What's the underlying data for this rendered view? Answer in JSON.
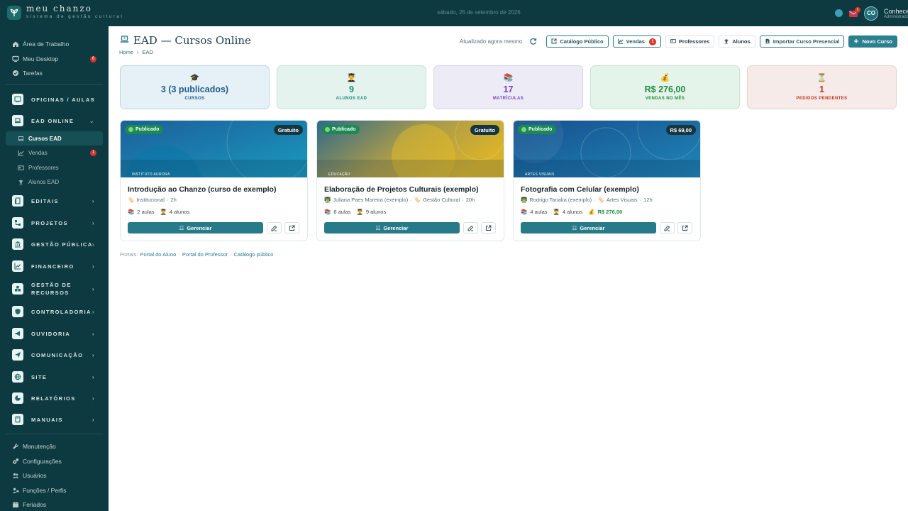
{
  "app": {
    "brand_name": "meu chanzo",
    "brand_subtitle": "sistema de gestão cultural",
    "date": "sábado, 26 de setembro de 2026",
    "notif_count": "1",
    "user_initials": "CO",
    "user_name": "Conhecer",
    "user_role": "Administrador"
  },
  "sidebar": {
    "top_items": [
      {
        "label": "Área de Trabalho",
        "icon": "home-icon"
      },
      {
        "label": "Meu Desktop",
        "icon": "monitor-icon",
        "badge": "6"
      },
      {
        "label": "Tarefas",
        "icon": "check-circle-icon"
      }
    ],
    "groups": [
      {
        "label": "OFICINAS / AULAS",
        "icon": "chalkboard-icon"
      },
      {
        "label": "EAD ONLINE",
        "icon": "laptop-icon",
        "expanded": true
      },
      {
        "label": "EDITAIS",
        "icon": "document-icon"
      },
      {
        "label": "PROJETOS",
        "icon": "diagram-icon"
      },
      {
        "label": "GESTÃO PÚBLICA",
        "icon": "bank-icon"
      },
      {
        "label": "FINANCEIRO",
        "icon": "chart-line-icon"
      },
      {
        "label": "GESTÃO DE RECURSOS",
        "icon": "boxes-icon"
      },
      {
        "label": "CONTROLADORIA",
        "icon": "shield-icon"
      },
      {
        "label": "OUVIDORIA",
        "icon": "megaphone-icon"
      },
      {
        "label": "COMUNICAÇÃO",
        "icon": "send-icon"
      },
      {
        "label": "SITE",
        "icon": "globe-icon"
      },
      {
        "label": "RELATÓRIOS",
        "icon": "pie-chart-icon"
      },
      {
        "label": "MANUAIS",
        "icon": "book-icon"
      }
    ],
    "ead_sub": [
      {
        "label": "Cursos EAD",
        "icon": "laptop-icon",
        "active": true
      },
      {
        "label": "Vendas",
        "icon": "chart-line-icon",
        "badge": "1"
      },
      {
        "label": "Professores",
        "icon": "id-card-icon"
      },
      {
        "label": "Alunos EAD",
        "icon": "student-icon"
      }
    ],
    "bottom_items": [
      {
        "label": "Manutenção",
        "icon": "wrench-icon"
      },
      {
        "label": "Configurações",
        "icon": "gears-icon"
      },
      {
        "label": "Usuários",
        "icon": "users-icon"
      },
      {
        "label": "Funções / Perfis",
        "icon": "user-tag-icon"
      },
      {
        "label": "Feriados",
        "icon": "calendar-icon"
      }
    ]
  },
  "page": {
    "title": "EAD — Cursos Online",
    "breadcrumb_home": "Home",
    "breadcrumb_current": "EAD",
    "updated_text": "Atualizado agora mesmo",
    "buttons": {
      "catalog": "Catálogo Público",
      "sales": "Vendas",
      "sales_badge": "1",
      "teachers": "Professores",
      "students": "Alunos",
      "import": "Importar Curso Presencial",
      "new": "Novo Curso"
    }
  },
  "stats": [
    {
      "icon": "🎓",
      "value": "3 (3 publicados)",
      "label": "CURSOS"
    },
    {
      "icon": "👨‍🎓",
      "value": "9",
      "label": "ALUNOS EAD"
    },
    {
      "icon": "📚",
      "value": "17",
      "label": "MATRÍCULAS"
    },
    {
      "icon": "💰",
      "value": "R$ 276,00",
      "label": "VENDAS NO MÊS"
    },
    {
      "icon": "⏳",
      "value": "1",
      "label": "PEDIDOS PENDENTES"
    }
  ],
  "courses": [
    {
      "status": "Publicado",
      "price": "Gratuito",
      "area": "INSTITUTO AURORA",
      "title": "Introdução ao Chanzo (curso de exemplo)",
      "teacher": "",
      "category": "Institucional",
      "hours": "2h",
      "lessons": "2 aulas",
      "students": "4 alunos",
      "revenue": "",
      "manage": "Gerenciar",
      "colors": [
        "#1c5f9a",
        "#1a9bbf"
      ]
    },
    {
      "status": "Publicado",
      "price": "Gratuito",
      "area": "EDUCAÇÃO",
      "title": "Elaboração de Projetos Culturais (exemplo)",
      "teacher": "Juliana Paes Moreira (exemplo)",
      "category": "Gestão Cultural",
      "hours": "20h",
      "lessons": "6 aulas",
      "students": "9 alunos",
      "revenue": "",
      "manage": "Gerenciar",
      "colors": [
        "#2f6a8a",
        "#d8b22a"
      ]
    },
    {
      "status": "Publicado",
      "price": "R$ 69,00",
      "area": "ARTES VISUAIS",
      "title": "Fotografia com Celular (exemplo)",
      "teacher": "Rodrigo Tanaka (exemplo)",
      "category": "Artes Visuais",
      "hours": "12h",
      "lessons": "4 aulas",
      "students": "4 alunos",
      "revenue": "R$ 276,00",
      "manage": "Gerenciar",
      "colors": [
        "#17508e",
        "#1f87b8"
      ]
    }
  ],
  "portals": {
    "label": "Portais:",
    "student": "Portal do Aluno",
    "teacher": "Portal do Professor",
    "catalog": "Catálogo público"
  }
}
